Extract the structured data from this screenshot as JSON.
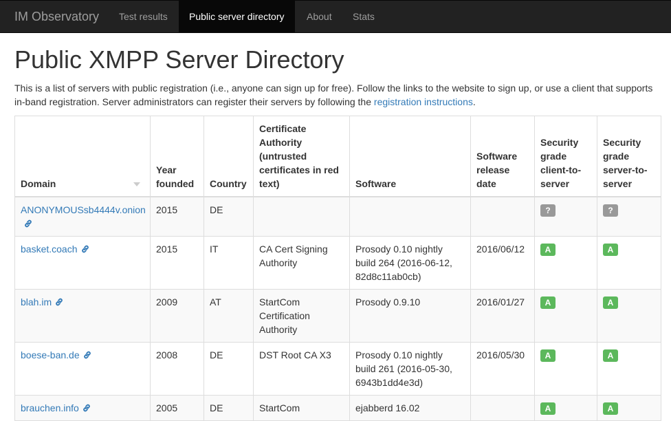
{
  "navbar": {
    "brand": "IM Observatory",
    "items": [
      {
        "label": "Test results",
        "active": false
      },
      {
        "label": "Public server directory",
        "active": true
      },
      {
        "label": "About",
        "active": false
      },
      {
        "label": "Stats",
        "active": false
      }
    ]
  },
  "page": {
    "title": "Public XMPP Server Directory",
    "intro_text": "This is a list of servers with public registration (i.e., anyone can sign up for free). Follow the links to the website to sign up, or use a client that supports in-band registration. Server administrators can register their servers by following the ",
    "intro_link": "registration instructions",
    "intro_end": "."
  },
  "table": {
    "headers": {
      "domain": "Domain",
      "year": "Year founded",
      "country": "Country",
      "ca": "Certificate Authority (untrusted certificates in red text)",
      "software": "Software",
      "release": "Software release date",
      "grade_c2s": "Security grade client-to-server",
      "grade_s2s": "Security grade server-to-server"
    },
    "rows": [
      {
        "domain": "ANONYMOUSsb4444v.onion",
        "year": "2015",
        "country": "DE",
        "ca": "",
        "software": "",
        "release": "",
        "c2s": "?",
        "s2s": "?"
      },
      {
        "domain": "basket.coach",
        "year": "2015",
        "country": "IT",
        "ca": "CA Cert Signing Authority",
        "software": "Prosody 0.10 nightly build 264 (2016-06-12, 82d8c11ab0cb)",
        "release": "2016/06/12",
        "c2s": "A",
        "s2s": "A"
      },
      {
        "domain": "blah.im",
        "year": "2009",
        "country": "AT",
        "ca": "StartCom Certification Authority",
        "software": "Prosody 0.9.10",
        "release": "2016/01/27",
        "c2s": "A",
        "s2s": "A"
      },
      {
        "domain": "boese-ban.de",
        "year": "2008",
        "country": "DE",
        "ca": "DST Root CA X3",
        "software": "Prosody 0.10 nightly build 261 (2016-05-30, 6943b1dd4e3d)",
        "release": "2016/05/30",
        "c2s": "A",
        "s2s": "A"
      },
      {
        "domain": "brauchen.info",
        "year": "2005",
        "country": "DE",
        "ca": "StartCom",
        "software": "ejabberd 16.02",
        "release": "",
        "c2s": "A",
        "s2s": "A"
      }
    ]
  },
  "colors": {
    "grade_a": "#5cb85c",
    "grade_unknown": "#999999",
    "link": "#337ab7",
    "navbar_bg": "#222222"
  }
}
